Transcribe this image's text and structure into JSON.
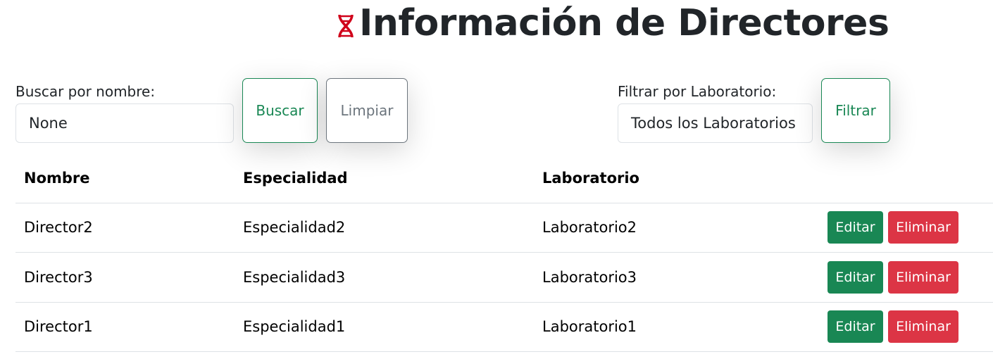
{
  "header": {
    "title": "Información de Directores",
    "icon": "dna-icon",
    "icon_color": "#d0021b"
  },
  "search": {
    "label": "Buscar por nombre:",
    "value": "None",
    "search_button": "Buscar",
    "clear_button": "Limpiar"
  },
  "filter": {
    "label": "Filtrar por Laboratorio:",
    "selected": "Todos los Laboratorios",
    "filter_button": "Filtrar"
  },
  "table": {
    "headers": [
      "Nombre",
      "Especialidad",
      "Laboratorio"
    ],
    "rows": [
      {
        "nombre": "Director2",
        "especialidad": "Especialidad2",
        "laboratorio": "Laboratorio2",
        "edit": "Editar",
        "delete": "Eliminar"
      },
      {
        "nombre": "Director3",
        "especialidad": "Especialidad3",
        "laboratorio": "Laboratorio3",
        "edit": "Editar",
        "delete": "Eliminar"
      },
      {
        "nombre": "Director1",
        "especialidad": "Especialidad1",
        "laboratorio": "Laboratorio1",
        "edit": "Editar",
        "delete": "Eliminar"
      }
    ]
  },
  "colors": {
    "success": "#198754",
    "danger": "#dc3545",
    "secondary": "#6c757d"
  }
}
